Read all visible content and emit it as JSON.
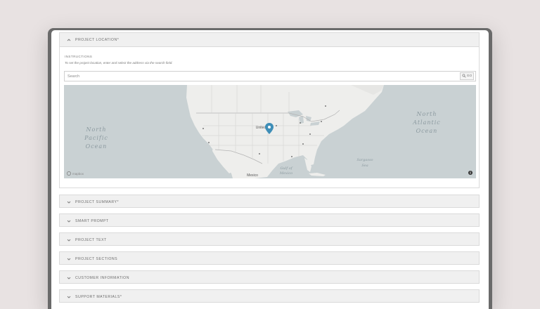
{
  "sections": {
    "location": {
      "title": "PROJECT LOCATION*",
      "instructions_label": "INSTRUCTIONS",
      "instructions_text": "To set the project location, enter and select the address via the search field.",
      "search_placeholder": "Search",
      "go_label": "GO"
    },
    "collapsed": [
      {
        "title": "PROJECT SUMMARY*"
      },
      {
        "title": "SMART PROMPT"
      },
      {
        "title": "PROJECT TEXT"
      },
      {
        "title": "PROJECT SECTIONS"
      },
      {
        "title": "CUSTOMER INFORMATION"
      },
      {
        "title": "SUPPORT MATERIALS*"
      }
    ]
  },
  "map": {
    "labels": {
      "north_pacific": [
        "North",
        "Pacific",
        "Ocean"
      ],
      "north_atlantic": [
        "North",
        "Atlantic",
        "Ocean"
      ],
      "sargasso": [
        "Sargasso",
        "Sea"
      ],
      "gulf": [
        "Gulf of",
        "Mexico"
      ],
      "mexico": "Mexico",
      "united_states": "United",
      "attribution": "mapbox"
    },
    "colors": {
      "water": "#c9d1d3",
      "land": "#eeeeec",
      "border": "#b4b4b4",
      "pin": "#3e8eb7"
    }
  }
}
